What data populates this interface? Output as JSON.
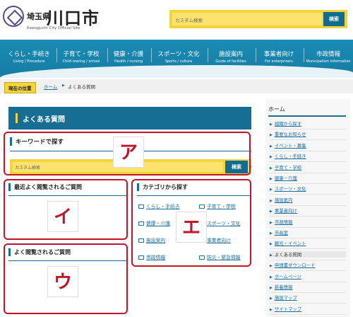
{
  "header": {
    "prefecture": "埼玉県",
    "city": "川口市",
    "subtitle": "Kawaguchi City Official Site",
    "search_placeholder": "カスタム検索",
    "search_button": "検索"
  },
  "nav": [
    {
      "jp": "くらし・手続き",
      "en": "Living / Procedure"
    },
    {
      "jp": "子育て・学校",
      "en": "Child rearing / school"
    },
    {
      "jp": "健康・介護",
      "en": "Health / nursing"
    },
    {
      "jp": "スポーツ・文化",
      "en": "Sports / culture"
    },
    {
      "jp": "施設案内",
      "en": "Guide of facilities"
    },
    {
      "jp": "事業者向け",
      "en": "For enterprisers"
    },
    {
      "jp": "市政情報",
      "en": "Municipalism information"
    }
  ],
  "breadcrumb": {
    "label": "現在の位置",
    "home": "ホーム",
    "current": "よくある質問"
  },
  "main": {
    "heading": "よくある質問",
    "keyword": {
      "title": "キーワードで探す",
      "placeholder": "カスタム検索",
      "button": "検索"
    },
    "recent_title": "最近よく閲覧されるご質問",
    "popular_title": "よく閲覧されるご質問",
    "category_title": "カテゴリから探す",
    "categories": [
      "くらし・手続き",
      "子育て・学校",
      "健康・介護",
      "スポーツ・文化",
      "施設案内",
      "事業者向け",
      "市政情報",
      "防災・緊急情報"
    ]
  },
  "annotations": {
    "a": "ア",
    "i": "イ",
    "u": "ウ",
    "e": "エ",
    "color": "#c0162a"
  },
  "sidebar": {
    "title": "ホーム",
    "items": [
      "組織から探す",
      "重要なお知らせ",
      "イベント・募集",
      "くらし・手続き",
      "子育て・学校",
      "健康・介護",
      "スポーツ・文化",
      "施設案内",
      "事業者向け",
      "市政情報",
      "市長室",
      "観光・イベント",
      "よくある質問",
      "申請書ダウンロード",
      "ホームページ",
      "新着情報",
      "施設マップ",
      "サイトマップ"
    ],
    "current_index": 12
  },
  "colors": {
    "brand_blue": "#176e94",
    "nav_blue": "#1a8cb5",
    "accent_yellow": "#f5d43a",
    "link": "#1a6fa1"
  }
}
